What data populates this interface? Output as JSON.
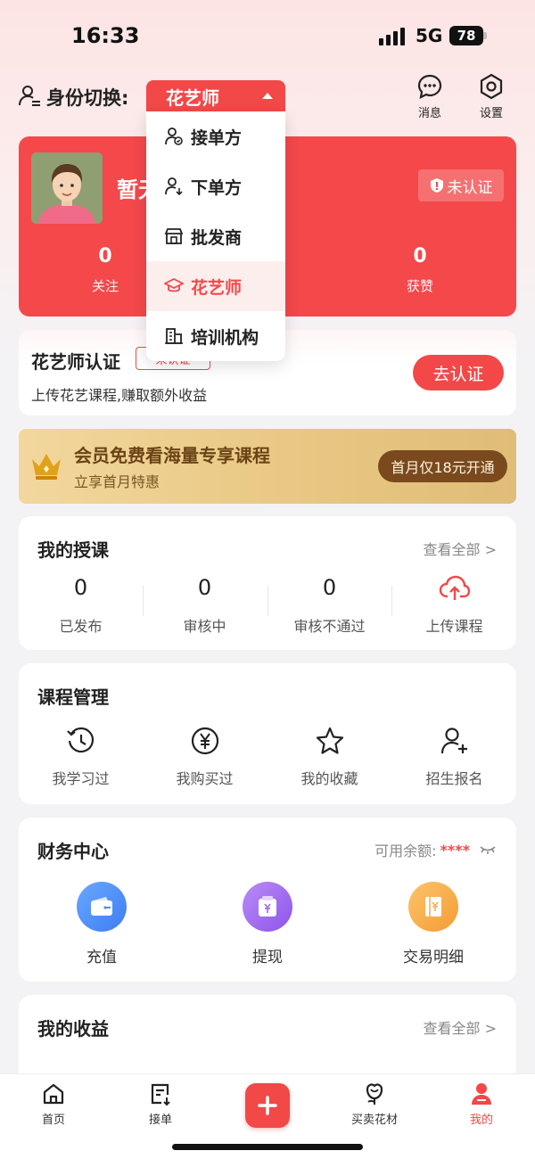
{
  "status_bar": {
    "time": "16:33",
    "network": "5G",
    "battery": "78"
  },
  "header": {
    "identity_label": "身份切换:",
    "current_role": "花艺师",
    "messages_label": "消息",
    "settings_label": "设置"
  },
  "role_menu": {
    "items": [
      {
        "label": "接单方",
        "icon": "user-check-icon"
      },
      {
        "label": "下单方",
        "icon": "user-download-icon"
      },
      {
        "label": "批发商",
        "icon": "store-icon"
      },
      {
        "label": "花艺师",
        "icon": "graduation-cap-icon",
        "active": true
      },
      {
        "label": "培训机构",
        "icon": "building-icon"
      }
    ]
  },
  "profile": {
    "nickname": "暂无",
    "verify_status": "未认证",
    "stats": [
      {
        "value": "0",
        "label": "关注"
      },
      {
        "value": "0",
        "label": "获赞"
      }
    ]
  },
  "florist_cert": {
    "title": "花艺师认证",
    "badge": "未认证",
    "subtitle": "上传花艺课程,赚取额外收益",
    "button": "去认证"
  },
  "vip_banner": {
    "title": "会员免费看海量专享课程",
    "subtitle": "立享首月特惠",
    "button": "首月仅18元开通"
  },
  "my_teaching": {
    "title": "我的授课",
    "view_all": "查看全部 >",
    "items": [
      {
        "value": "0",
        "label": "已发布"
      },
      {
        "value": "0",
        "label": "审核中"
      },
      {
        "value": "0",
        "label": "审核不通过"
      },
      {
        "value": "",
        "label": "上传课程",
        "icon": "cloud-upload-icon"
      }
    ]
  },
  "course_management": {
    "title": "课程管理",
    "items": [
      {
        "label": "我学习过",
        "icon": "history-icon"
      },
      {
        "label": "我购买过",
        "icon": "yen-icon"
      },
      {
        "label": "我的收藏",
        "icon": "star-icon"
      },
      {
        "label": "招生报名",
        "icon": "user-add-icon"
      }
    ]
  },
  "finance": {
    "title": "财务中心",
    "balance_label": "可用余额:",
    "balance_value": "****",
    "items": [
      {
        "label": "充值",
        "icon": "wallet-icon",
        "color": "#4f8ff7"
      },
      {
        "label": "提现",
        "icon": "withdraw-icon",
        "color": "#a571f0"
      },
      {
        "label": "交易明细",
        "icon": "ledger-icon",
        "color": "#f6ad4a"
      }
    ]
  },
  "earnings": {
    "title": "我的收益",
    "view_all": "查看全部 >"
  },
  "tabbar": {
    "items": [
      {
        "label": "首页",
        "icon": "home-icon"
      },
      {
        "label": "接单",
        "icon": "order-icon"
      },
      {
        "label": "",
        "icon": "plus-icon"
      },
      {
        "label": "买卖花材",
        "icon": "flower-icon"
      },
      {
        "label": "我的",
        "icon": "profile-icon",
        "active": true
      }
    ]
  },
  "colors": {
    "accent": "#f24848",
    "gold": "#e9c985"
  }
}
